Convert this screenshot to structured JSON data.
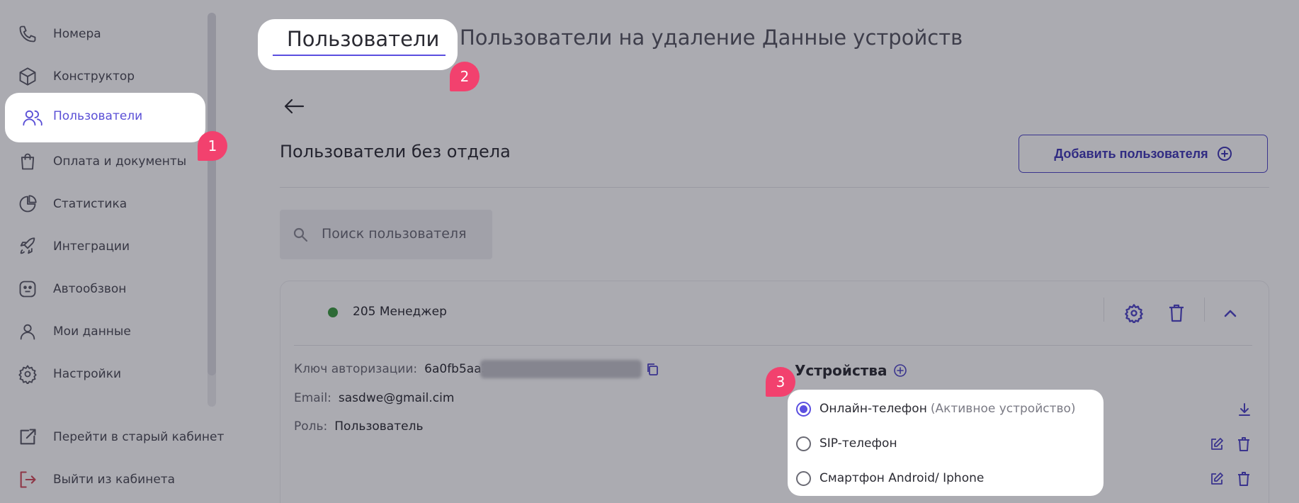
{
  "sidebar": {
    "items": [
      {
        "label": "Номера",
        "icon": "phone-icon"
      },
      {
        "label": "Конструктор",
        "icon": "cube-icon"
      },
      {
        "label": "Пользователи",
        "icon": "users-icon",
        "active": true
      },
      {
        "label": "Оплата и документы",
        "icon": "shopping-bag-icon"
      },
      {
        "label": "Статистика",
        "icon": "pie-chart-icon"
      },
      {
        "label": "Интеграции",
        "icon": "rocket-icon"
      },
      {
        "label": "Автообзвон",
        "icon": "robot-icon"
      },
      {
        "label": "Мои данные",
        "icon": "user-icon"
      },
      {
        "label": "Настройки",
        "icon": "gear-icon"
      }
    ],
    "bottom": [
      {
        "label": "Перейти в старый кабинет",
        "icon": "external-link-icon"
      },
      {
        "label": "Выйти из кабинета",
        "icon": "logout-icon"
      }
    ]
  },
  "tabs": [
    {
      "label": "Пользователи",
      "active": true
    },
    {
      "label": "Пользователи на удаление"
    },
    {
      "label": "Данные устройств"
    }
  ],
  "page": {
    "title": "Пользователи без отдела",
    "add_button": "Добавить пользователя",
    "search_placeholder": "Поиск пользователя"
  },
  "user": {
    "name": "205 Менеджер",
    "status_color": "#3a9a3f",
    "auth_key_label": "Ключ авторизации:",
    "auth_key_value": "6a0fb5aa3c",
    "email_label": "Email:",
    "email_value": "sasdwe@gmail.cim",
    "role_label": "Роль:",
    "role_value": "Пользователь"
  },
  "devices": {
    "title": "Устройства",
    "items": [
      {
        "label": "Онлайн-телефон",
        "note": "(Активное устройство)",
        "selected": true
      },
      {
        "label": "SIP-телефон",
        "selected": false
      },
      {
        "label": "Смартфон Android/ Iphone",
        "selected": false
      }
    ]
  },
  "annotations": [
    "1",
    "2",
    "3"
  ],
  "colors": {
    "accent": "#5b4fe0",
    "badge": "#f2416e",
    "overlay": "rgba(22,22,38,0.36)"
  }
}
